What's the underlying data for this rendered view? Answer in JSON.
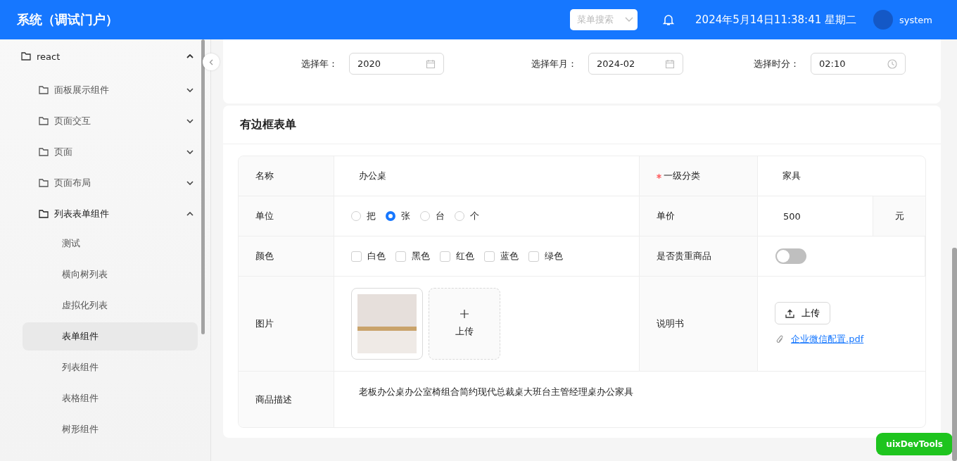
{
  "header": {
    "title": "系统（调试门户）",
    "menu_search": {
      "placeholder": "菜单搜索"
    },
    "datetime": "2024年5月14日11:38:41 星期二",
    "user": "system"
  },
  "sidebar": {
    "tree": [
      {
        "label": "react",
        "expanded": true,
        "children": [
          {
            "label": "面板展示组件",
            "expanded": false
          },
          {
            "label": "页面交互",
            "expanded": false
          },
          {
            "label": "页面",
            "expanded": false
          },
          {
            "label": "页面布局",
            "expanded": false
          },
          {
            "label": "列表表单组件",
            "expanded": true,
            "children": [
              {
                "label": "测试",
                "selected": false
              },
              {
                "label": "横向树列表",
                "selected": false
              },
              {
                "label": "虚拟化列表",
                "selected": false
              },
              {
                "label": "表单组件",
                "selected": true
              },
              {
                "label": "列表组件",
                "selected": false
              },
              {
                "label": "表格组件",
                "selected": false
              },
              {
                "label": "树形组件",
                "selected": false
              }
            ]
          }
        ]
      }
    ]
  },
  "pickers": [
    {
      "label": "选择年：",
      "value": "2020",
      "kind": "date"
    },
    {
      "label": "选择年月：",
      "value": "2024-02",
      "kind": "date"
    },
    {
      "label": "选择时分：",
      "value": "02:10",
      "kind": "time"
    }
  ],
  "bordered_form": {
    "title": "有边框表单",
    "name": {
      "label": "名称",
      "required": false,
      "value": "办公桌"
    },
    "category": {
      "label": "一级分类",
      "required": true,
      "value": "家具"
    },
    "unit": {
      "label": "单位",
      "required": false,
      "options": [
        {
          "label": "把",
          "selected": false
        },
        {
          "label": "张",
          "selected": true
        },
        {
          "label": "台",
          "selected": false
        },
        {
          "label": "个",
          "selected": false
        }
      ]
    },
    "price": {
      "label": "单价",
      "required": false,
      "value": "500",
      "suffix": "元"
    },
    "color": {
      "label": "颜色",
      "required": false,
      "options": [
        {
          "label": "白色",
          "checked": false
        },
        {
          "label": "黑色",
          "checked": false
        },
        {
          "label": "红色",
          "checked": false
        },
        {
          "label": "蓝色",
          "checked": false
        },
        {
          "label": "绿色",
          "checked": false
        }
      ]
    },
    "valuable": {
      "label": "是否贵重商品",
      "required": false,
      "on": false
    },
    "picture": {
      "label": "图片",
      "required": false,
      "upload_label": "上传"
    },
    "manual": {
      "label": "说明书",
      "required": false,
      "button": "上传",
      "file": "企业微信配置.pdf"
    },
    "description": {
      "label": "商品描述",
      "required": false,
      "value": "老板办公桌办公室椅组合简约现代总裁桌大班台主管经理桌办公家具"
    }
  },
  "devtools_button": "uixDevTools"
}
